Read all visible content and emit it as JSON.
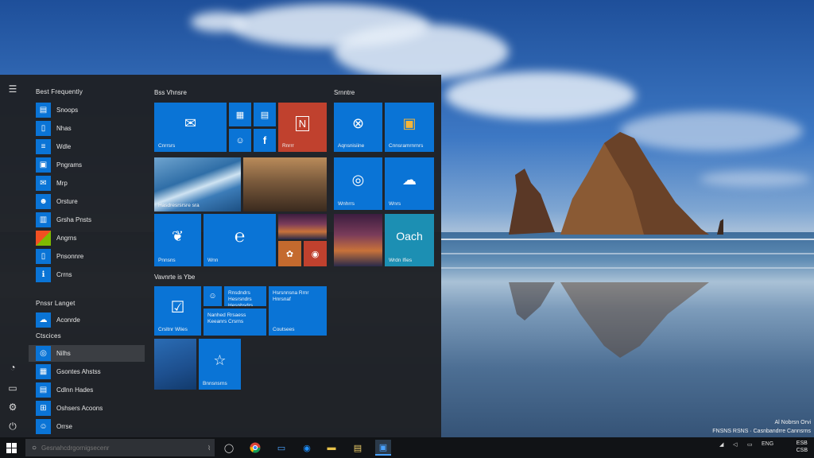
{
  "start_menu": {
    "most_used_label": "Best Frequently",
    "apps": [
      {
        "label": "Snoops",
        "icon": "folder-icon"
      },
      {
        "label": "Nhas",
        "icon": "file-icon"
      },
      {
        "label": "Wdle",
        "icon": "document-icon"
      },
      {
        "label": "Pngrams",
        "icon": "photos-icon"
      },
      {
        "label": "Mrp",
        "icon": "mail-icon"
      },
      {
        "label": "Orsture",
        "icon": "people-icon"
      },
      {
        "label": "Grsha Pnsts",
        "icon": "chart-icon"
      },
      {
        "label": "Angrns",
        "icon": "store-icon"
      },
      {
        "label": "Pnsonnre",
        "icon": "settings-icon"
      },
      {
        "label": "Crrns",
        "icon": "info-icon"
      }
    ],
    "recent_label": "Pnssr Langet",
    "recent_apps": [
      {
        "label": "Aconrde",
        "icon": "cloud-icon"
      }
    ],
    "recent2_label": "Ctscices",
    "recent2_apps": [
      {
        "label": "Nilhs",
        "icon": "edge-icon"
      },
      {
        "label": "Gsontes Ahstss",
        "icon": "grid-icon"
      },
      {
        "label": "Cdlnn Hades",
        "icon": "calendar-icon"
      },
      {
        "label": "Oshsers Acoons",
        "icon": "windows-icon"
      },
      {
        "label": "Orrse",
        "icon": "people-icon"
      }
    ],
    "group1_title": "Bss Vhnsre",
    "group2_title": "Srnntre",
    "group3_title": "Vavnrte is Ybe",
    "tiles": {
      "mail": "Cnrrsrs",
      "photo1": "Hasdresrsrsre sra",
      "onenote": "Rnrrr",
      "t_photos": "Pnnsns",
      "t_edge": "Wnn",
      "skype": "Aqnsnisiine",
      "store_tile": "Cnnsramrnrnrs",
      "edge2": "Wnhrrs",
      "weather": "Wnrs",
      "news_tile": "Oach",
      "news_label": "Wrdn Ifies",
      "todo": "Crsltnr Wlies",
      "people_desc": "Rnsdndrs Hesrsndrs Hesnhsdrs",
      "news2_desc": "Nanhed Rrsaess Keeanrs Crsrns",
      "rfb_desc": "Hsrsnnsna Rrnr Hnrsnaf",
      "rfb_label": "Coutsees",
      "fav_label": "Bnnsnsrns"
    }
  },
  "taskbar": {
    "search_placeholder": "Gesnahcdrgornigsecenr"
  },
  "tray": {
    "lang": "ENG",
    "time": "ESB",
    "date": "CSB"
  },
  "notice": {
    "line1": "Al Nobrsn Orvi",
    "line2": "Casnbandrre Cannsrns",
    "small1": "FNSNS RSNS"
  }
}
